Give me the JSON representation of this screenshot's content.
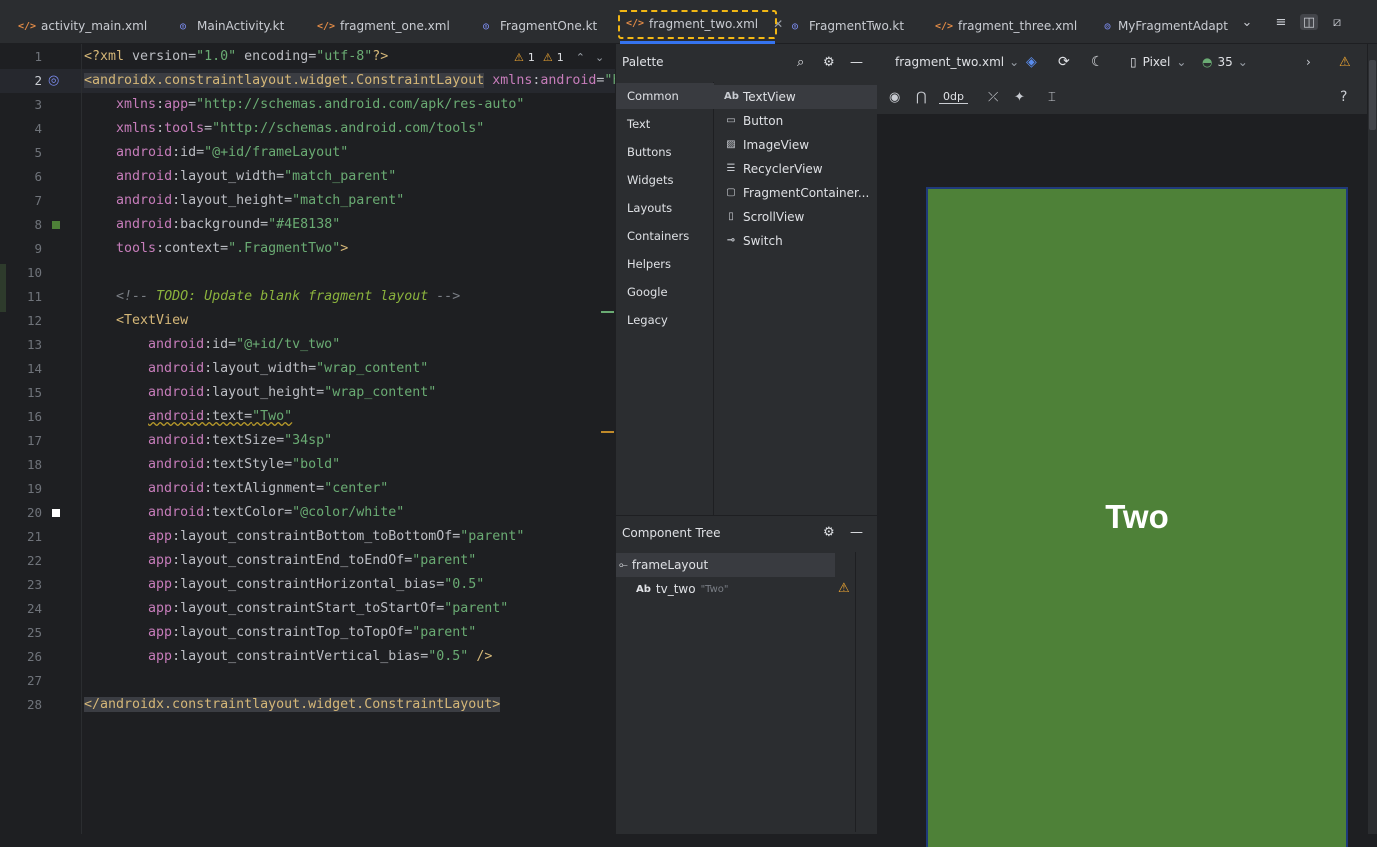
{
  "tabs": [
    {
      "label": "activity_main.xml",
      "type": "xml"
    },
    {
      "label": "MainActivity.kt",
      "type": "kt"
    },
    {
      "label": "fragment_one.xml",
      "type": "xml"
    },
    {
      "label": "FragmentOne.kt",
      "type": "kt"
    },
    {
      "label": "fragment_two.xml",
      "type": "xml",
      "active": true,
      "close": "✕"
    },
    {
      "label": "FragmentTwo.kt",
      "type": "kt"
    },
    {
      "label": "fragment_three.xml",
      "type": "xml"
    },
    {
      "label": "MyFragmentAdapt",
      "type": "kt"
    }
  ],
  "editor": {
    "line_numbers": [
      "1",
      "2",
      "3",
      "4",
      "5",
      "6",
      "7",
      "8",
      "9",
      "10",
      "11",
      "12",
      "13",
      "14",
      "15",
      "16",
      "17",
      "18",
      "19",
      "20",
      "21",
      "22",
      "23",
      "24",
      "25",
      "26",
      "27",
      "28"
    ],
    "warnings": {
      "count1": "1",
      "count2": "1"
    },
    "lines": [
      [
        {
          "c": "tg",
          "t": "<?xml "
        },
        {
          "c": "at",
          "t": "version"
        },
        {
          "c": "pl",
          "t": "="
        },
        {
          "c": "av",
          "t": "\"1.0\""
        },
        {
          "c": "pl",
          "t": " "
        },
        {
          "c": "at",
          "t": "encoding"
        },
        {
          "c": "pl",
          "t": "="
        },
        {
          "c": "av",
          "t": "\"utf-8\""
        },
        {
          "c": "tg",
          "t": "?>"
        }
      ],
      [
        {
          "c": "tg tagbg",
          "t": "<androidx.constraintlayout.widget.ConstraintLayout"
        },
        {
          "c": "pl",
          "t": " "
        },
        {
          "c": "an",
          "t": "xmlns"
        },
        {
          "c": "pl",
          "t": ":"
        },
        {
          "c": "an",
          "t": "android"
        },
        {
          "c": "pl",
          "t": "="
        },
        {
          "c": "av",
          "t": "\"http://schemas.android.com/apk/res/android\""
        }
      ],
      [
        {
          "c": "pl",
          "t": "    "
        },
        {
          "c": "an",
          "t": "xmlns"
        },
        {
          "c": "pl",
          "t": ":"
        },
        {
          "c": "an",
          "t": "app"
        },
        {
          "c": "pl",
          "t": "="
        },
        {
          "c": "av",
          "t": "\"http://schemas.android.com/apk/res-auto\""
        }
      ],
      [
        {
          "c": "pl",
          "t": "    "
        },
        {
          "c": "an",
          "t": "xmlns"
        },
        {
          "c": "pl",
          "t": ":"
        },
        {
          "c": "an",
          "t": "tools"
        },
        {
          "c": "pl",
          "t": "="
        },
        {
          "c": "av",
          "t": "\"http://schemas.android.com/tools\""
        }
      ],
      [
        {
          "c": "pl",
          "t": "    "
        },
        {
          "c": "an",
          "t": "android"
        },
        {
          "c": "pl",
          "t": ":id="
        },
        {
          "c": "av",
          "t": "\"@+id/frameLayout\""
        }
      ],
      [
        {
          "c": "pl",
          "t": "    "
        },
        {
          "c": "an",
          "t": "android"
        },
        {
          "c": "pl",
          "t": ":layout_width="
        },
        {
          "c": "av",
          "t": "\"match_parent\""
        }
      ],
      [
        {
          "c": "pl",
          "t": "    "
        },
        {
          "c": "an",
          "t": "android"
        },
        {
          "c": "pl",
          "t": ":layout_height="
        },
        {
          "c": "av",
          "t": "\"match_parent\""
        }
      ],
      [
        {
          "c": "pl",
          "t": "    "
        },
        {
          "c": "an",
          "t": "android"
        },
        {
          "c": "pl",
          "t": ":background="
        },
        {
          "c": "av",
          "t": "\"#4E8138\""
        }
      ],
      [
        {
          "c": "pl",
          "t": "    "
        },
        {
          "c": "an",
          "t": "tools"
        },
        {
          "c": "pl",
          "t": ":context="
        },
        {
          "c": "av",
          "t": "\".FragmentTwo\""
        },
        {
          "c": "tg",
          "t": ">"
        }
      ],
      [],
      [
        {
          "c": "pl",
          "t": "    "
        },
        {
          "c": "cm",
          "t": "<!-- "
        },
        {
          "c": "cmt",
          "t": "TODO: Update blank fragment layout"
        },
        {
          "c": "cm",
          "t": " -->"
        }
      ],
      [
        {
          "c": "pl",
          "t": "    "
        },
        {
          "c": "tg",
          "t": "<TextView"
        }
      ],
      [
        {
          "c": "pl",
          "t": "        "
        },
        {
          "c": "an",
          "t": "android"
        },
        {
          "c": "pl",
          "t": ":id="
        },
        {
          "c": "av",
          "t": "\"@+id/tv_two\""
        }
      ],
      [
        {
          "c": "pl",
          "t": "        "
        },
        {
          "c": "an",
          "t": "android"
        },
        {
          "c": "pl",
          "t": ":layout_width="
        },
        {
          "c": "av",
          "t": "\"wrap_content\""
        }
      ],
      [
        {
          "c": "pl",
          "t": "        "
        },
        {
          "c": "an",
          "t": "android"
        },
        {
          "c": "pl",
          "t": ":layout_height="
        },
        {
          "c": "av",
          "t": "\"wrap_content\""
        }
      ],
      [
        {
          "c": "pl",
          "t": "        "
        },
        {
          "c": "an wavy",
          "t": "android"
        },
        {
          "c": "pl wavy",
          "t": ":text="
        },
        {
          "c": "av wavy",
          "t": "\"Two\""
        }
      ],
      [
        {
          "c": "pl",
          "t": "        "
        },
        {
          "c": "an",
          "t": "android"
        },
        {
          "c": "pl",
          "t": ":textSize="
        },
        {
          "c": "av",
          "t": "\"34sp\""
        }
      ],
      [
        {
          "c": "pl",
          "t": "        "
        },
        {
          "c": "an",
          "t": "android"
        },
        {
          "c": "pl",
          "t": ":textStyle="
        },
        {
          "c": "av",
          "t": "\"bold\""
        }
      ],
      [
        {
          "c": "pl",
          "t": "        "
        },
        {
          "c": "an",
          "t": "android"
        },
        {
          "c": "pl",
          "t": ":textAlignment="
        },
        {
          "c": "av",
          "t": "\"center\""
        }
      ],
      [
        {
          "c": "pl",
          "t": "        "
        },
        {
          "c": "an",
          "t": "android"
        },
        {
          "c": "pl",
          "t": ":textColor="
        },
        {
          "c": "av",
          "t": "\"@color/white\""
        }
      ],
      [
        {
          "c": "pl",
          "t": "        "
        },
        {
          "c": "an",
          "t": "app"
        },
        {
          "c": "pl",
          "t": ":layout_constraintBottom_toBottomOf="
        },
        {
          "c": "av",
          "t": "\"parent\""
        }
      ],
      [
        {
          "c": "pl",
          "t": "        "
        },
        {
          "c": "an",
          "t": "app"
        },
        {
          "c": "pl",
          "t": ":layout_constraintEnd_toEndOf="
        },
        {
          "c": "av",
          "t": "\"parent\""
        }
      ],
      [
        {
          "c": "pl",
          "t": "        "
        },
        {
          "c": "an",
          "t": "app"
        },
        {
          "c": "pl",
          "t": ":layout_constraintHorizontal_bias="
        },
        {
          "c": "av",
          "t": "\"0.5\""
        }
      ],
      [
        {
          "c": "pl",
          "t": "        "
        },
        {
          "c": "an",
          "t": "app"
        },
        {
          "c": "pl",
          "t": ":layout_constraintStart_toStartOf="
        },
        {
          "c": "av",
          "t": "\"parent\""
        }
      ],
      [
        {
          "c": "pl",
          "t": "        "
        },
        {
          "c": "an",
          "t": "app"
        },
        {
          "c": "pl",
          "t": ":layout_constraintTop_toTopOf="
        },
        {
          "c": "av",
          "t": "\"parent\""
        }
      ],
      [
        {
          "c": "pl",
          "t": "        "
        },
        {
          "c": "an",
          "t": "app"
        },
        {
          "c": "pl",
          "t": ":layout_constraintVertical_bias="
        },
        {
          "c": "av",
          "t": "\"0.5\""
        },
        {
          "c": "pl",
          "t": " "
        },
        {
          "c": "tg",
          "t": "/>"
        }
      ],
      [],
      [
        {
          "c": "tg tagbg",
          "t": "</androidx.constraintlayout.widget.ConstraintLayout>"
        }
      ]
    ],
    "background_swatch": "#4E8138",
    "white_swatch": "#FFFFFF"
  },
  "palette": {
    "title": "Palette",
    "categories": [
      "Common",
      "Text",
      "Buttons",
      "Widgets",
      "Layouts",
      "Containers",
      "Helpers",
      "Google",
      "Legacy"
    ],
    "items": [
      {
        "icon": "Ab",
        "label": "TextView"
      },
      {
        "icon": "▭",
        "label": "Button"
      },
      {
        "icon": "▨",
        "label": "ImageView"
      },
      {
        "icon": "☰",
        "label": "RecyclerView"
      },
      {
        "icon": "▢",
        "label": "FragmentContainer..."
      },
      {
        "icon": "▯",
        "label": "ScrollView"
      },
      {
        "icon": "⊸",
        "label": "Switch"
      }
    ]
  },
  "component_tree": {
    "title": "Component Tree",
    "root": "frameLayout",
    "child_icon": "Ab",
    "child": "tv_two",
    "child_hint": "\"Two\""
  },
  "design": {
    "file": "fragment_two.xml",
    "device": "Pixel",
    "api": "35",
    "margin": "0dp",
    "preview_text": "Two",
    "preview_bg": "#4E8138",
    "help": "?"
  }
}
